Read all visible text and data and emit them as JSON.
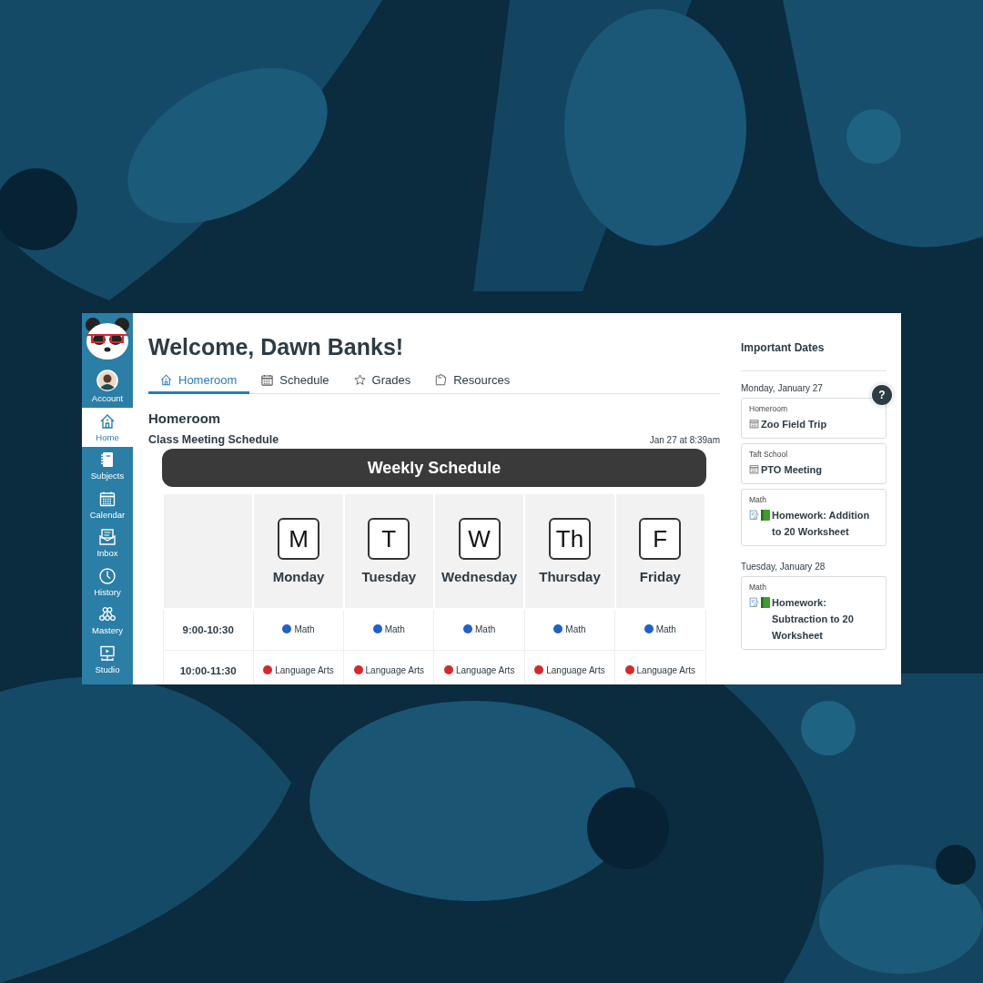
{
  "sidebar": {
    "items": [
      {
        "label": "Account",
        "kind": "avatar",
        "selected": false
      },
      {
        "label": "Home",
        "kind": "home",
        "selected": true
      },
      {
        "label": "Subjects",
        "kind": "notebook",
        "selected": false
      },
      {
        "label": "Calendar",
        "kind": "calendar",
        "selected": false
      },
      {
        "label": "Inbox",
        "kind": "inbox",
        "selected": false
      },
      {
        "label": "History",
        "kind": "clock",
        "selected": false
      },
      {
        "label": "Mastery",
        "kind": "nodes",
        "selected": false
      },
      {
        "label": "Studio",
        "kind": "monitor",
        "selected": false
      }
    ]
  },
  "main": {
    "title": "Welcome, Dawn Banks!",
    "tabs": [
      {
        "label": "Homeroom",
        "kind": "home",
        "selected": true
      },
      {
        "label": "Schedule",
        "kind": "calendar",
        "selected": false
      },
      {
        "label": "Grades",
        "kind": "star",
        "selected": false
      },
      {
        "label": "Resources",
        "kind": "folder",
        "selected": false
      }
    ],
    "section_title": "Homeroom",
    "post": {
      "title": "Class Meeting Schedule",
      "date": "Jan 27 at 8:39am"
    },
    "schedule": {
      "banner": "Weekly Schedule",
      "columns": [
        {
          "letter": "M",
          "day": "Monday"
        },
        {
          "letter": "T",
          "day": "Tuesday"
        },
        {
          "letter": "W",
          "day": "Wednesday"
        },
        {
          "letter": "Th",
          "day": "Thursday"
        },
        {
          "letter": "F",
          "day": "Friday"
        }
      ],
      "rows": [
        {
          "time": "9:00-10:30",
          "cells": [
            {
              "label": "Math",
              "color": "#2160c8"
            },
            {
              "label": "Math",
              "color": "#2160c8"
            },
            {
              "label": "Math",
              "color": "#2160c8"
            },
            {
              "label": "Math",
              "color": "#2160c8"
            },
            {
              "label": "Math",
              "color": "#2160c8"
            }
          ]
        },
        {
          "time": "10:00-11:30",
          "cells": [
            {
              "label": "Language Arts",
              "color": "#d42a2a"
            },
            {
              "label": "Language Arts",
              "color": "#d42a2a"
            },
            {
              "label": "Language Arts",
              "color": "#d42a2a"
            },
            {
              "label": "Language Arts",
              "color": "#d42a2a"
            },
            {
              "label": "Language Arts",
              "color": "#d42a2a"
            }
          ]
        }
      ]
    }
  },
  "dates": {
    "title": "Important Dates",
    "help_button": "?",
    "groups": [
      {
        "date": "Monday, January 27",
        "items": [
          {
            "context": "Homeroom",
            "kind": "event",
            "title": "Zoo Field Trip"
          },
          {
            "context": "Taft School",
            "kind": "event",
            "title": "PTO Meeting"
          },
          {
            "context": "Math",
            "kind": "assignment",
            "title": "Homework: Addition to 20 Worksheet"
          }
        ]
      },
      {
        "date": "Tuesday, January 28",
        "items": [
          {
            "context": "Math",
            "kind": "assignment",
            "title": "Homework: Subtraction to 20 Worksheet"
          }
        ]
      }
    ]
  }
}
